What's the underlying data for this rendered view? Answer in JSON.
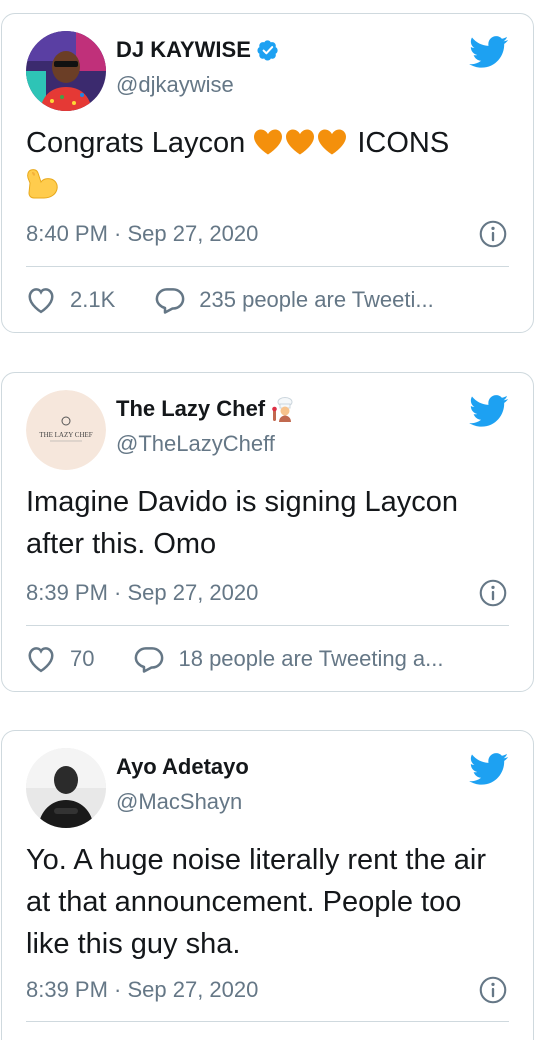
{
  "colors": {
    "accent": "#1da1f2",
    "border": "#cfd9de",
    "secondary_text": "#657786",
    "heart_orange": "#f4900c"
  },
  "tweets": [
    {
      "name": "DJ KAYWISE",
      "verified": true,
      "handle": "@djkaywise",
      "text_before": "Congrats Laycon ",
      "text_after": " ICONS",
      "emojis": [
        "orange-heart",
        "orange-heart",
        "orange-heart",
        "flexed-biceps"
      ],
      "time": "8:40 PM · Sep 27, 2020",
      "likes": "2.1K",
      "replies_text": "235 people are Tweeti..."
    },
    {
      "name": "The Lazy Chef",
      "verified": false,
      "handle": "@TheLazyCheff",
      "avatar_text": "THE LAZY CHEF",
      "text": "Imagine Davido is signing Laycon after this. Omo",
      "time": "8:39 PM · Sep 27, 2020",
      "likes": "70",
      "replies_text": "18 people are Tweeting a..."
    },
    {
      "name": "Ayo Adetayo",
      "verified": false,
      "handle": "@MacShayn",
      "text": "Yo. A huge noise literally rent the air at that announcement. People too like this guy sha.",
      "time": "8:39 PM · Sep 27, 2020"
    }
  ]
}
